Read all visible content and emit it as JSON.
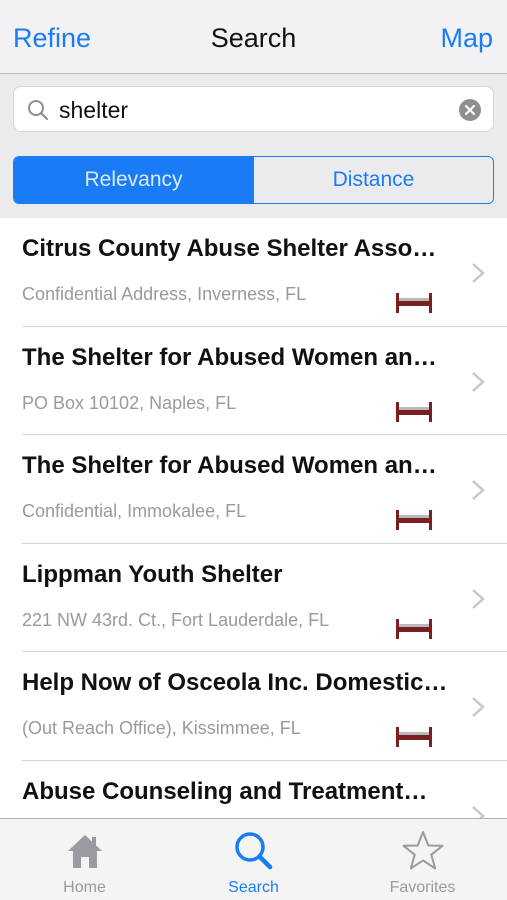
{
  "nav": {
    "left_label": "Refine",
    "title": "Search",
    "right_label": "Map"
  },
  "search": {
    "value": "shelter",
    "icon": "magnifier-icon",
    "clear_icon": "clear-circle-icon"
  },
  "segments": {
    "relevancy": "Relevancy",
    "distance": "Distance",
    "selected": "Relevancy"
  },
  "results": [
    {
      "title": "Citrus County Abuse Shelter Asso…",
      "address": "Confidential Address, Inverness, FL"
    },
    {
      "title": "The Shelter for Abused Women an…",
      "address": "PO Box 10102, Naples, FL"
    },
    {
      "title": "The Shelter for Abused Women an…",
      "address": "Confidential, Immokalee, FL"
    },
    {
      "title": "Lippman Youth Shelter",
      "address": "221 NW 43rd. Ct., Fort Lauderdale, FL"
    },
    {
      "title": "Help Now of Osceola Inc. Domestic…",
      "address": "(Out Reach Office), Kissimmee, FL"
    },
    {
      "title": "Abuse Counseling and Treatment…",
      "address": ""
    }
  ],
  "tabs": {
    "home": "Home",
    "search": "Search",
    "favorites": "Favorites",
    "selected": "Search"
  },
  "colors": {
    "accent": "#1a7cf5",
    "bed_icon": "#7a1f1f",
    "inactive_tab": "#9b9b9f"
  }
}
